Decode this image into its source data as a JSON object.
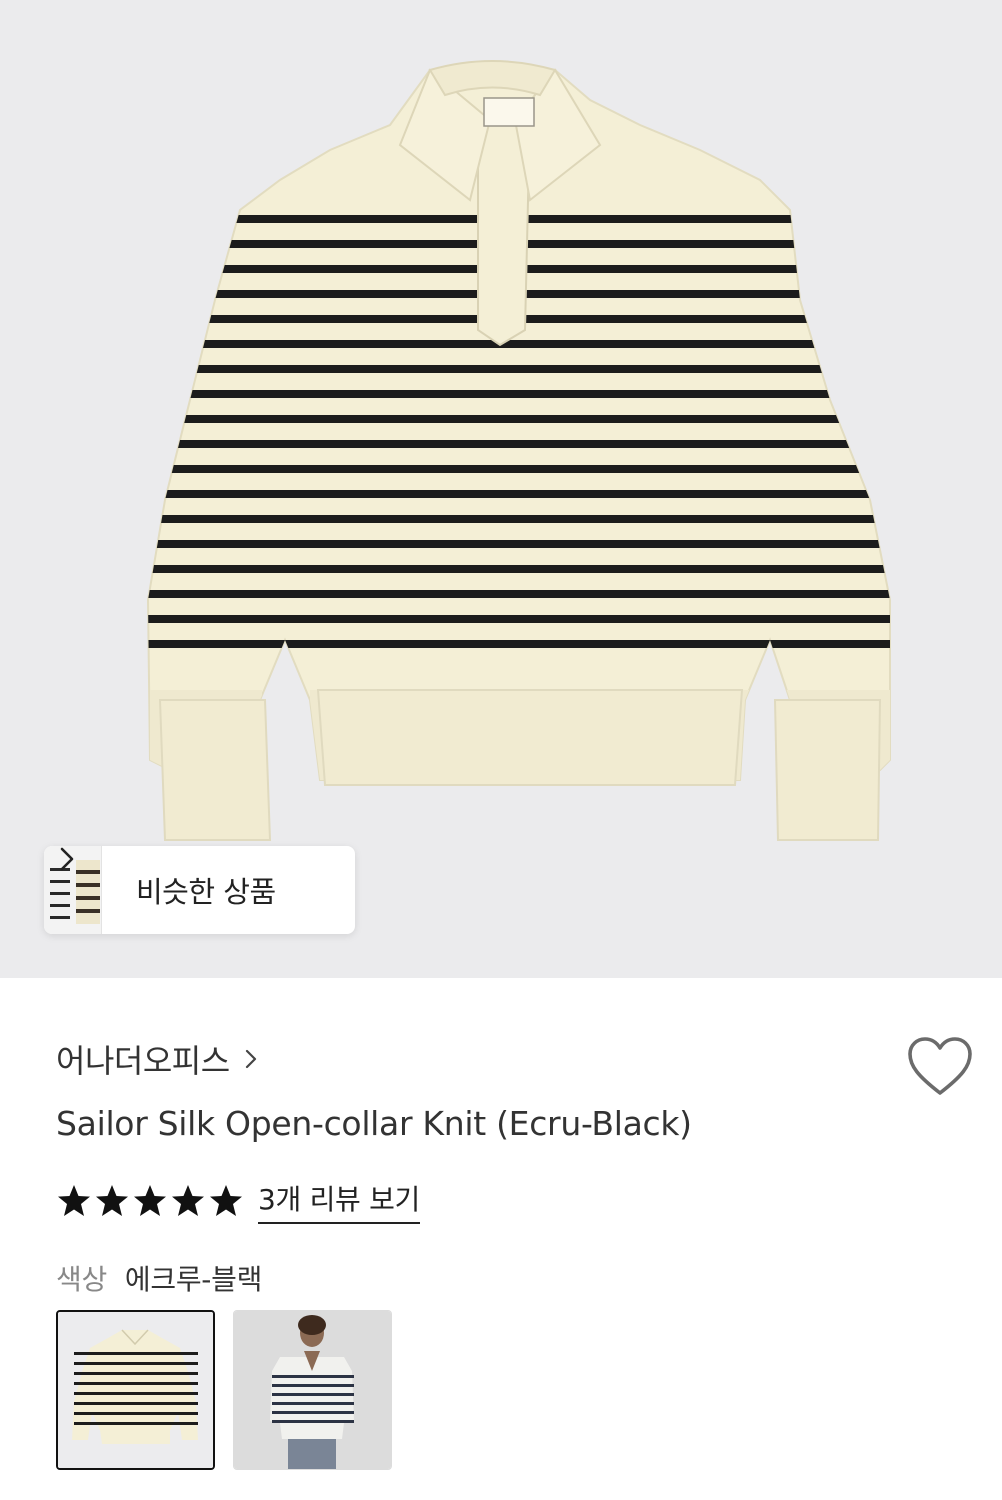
{
  "similar_products": {
    "label": "비슷한 상품"
  },
  "brand": {
    "name": "어나더오피스"
  },
  "product": {
    "title": "Sailor Silk Open-collar Knit (Ecru-Black)"
  },
  "rating": {
    "value": 5,
    "max": 5,
    "review_link": "3개 리뷰 보기"
  },
  "color": {
    "label": "색상",
    "selected": "에크루-블랙",
    "options": [
      {
        "name": "product-flat",
        "selected": true
      },
      {
        "name": "model-worn",
        "selected": false
      }
    ]
  },
  "colors": {
    "hero_bg": "#ebebed",
    "knit_ecru": "#f4efd6",
    "stripe_black": "#1c1c1c",
    "text_primary": "#333333",
    "text_muted": "#888888"
  },
  "icons": [
    "chevron-right-icon",
    "heart-icon",
    "star-icon"
  ]
}
